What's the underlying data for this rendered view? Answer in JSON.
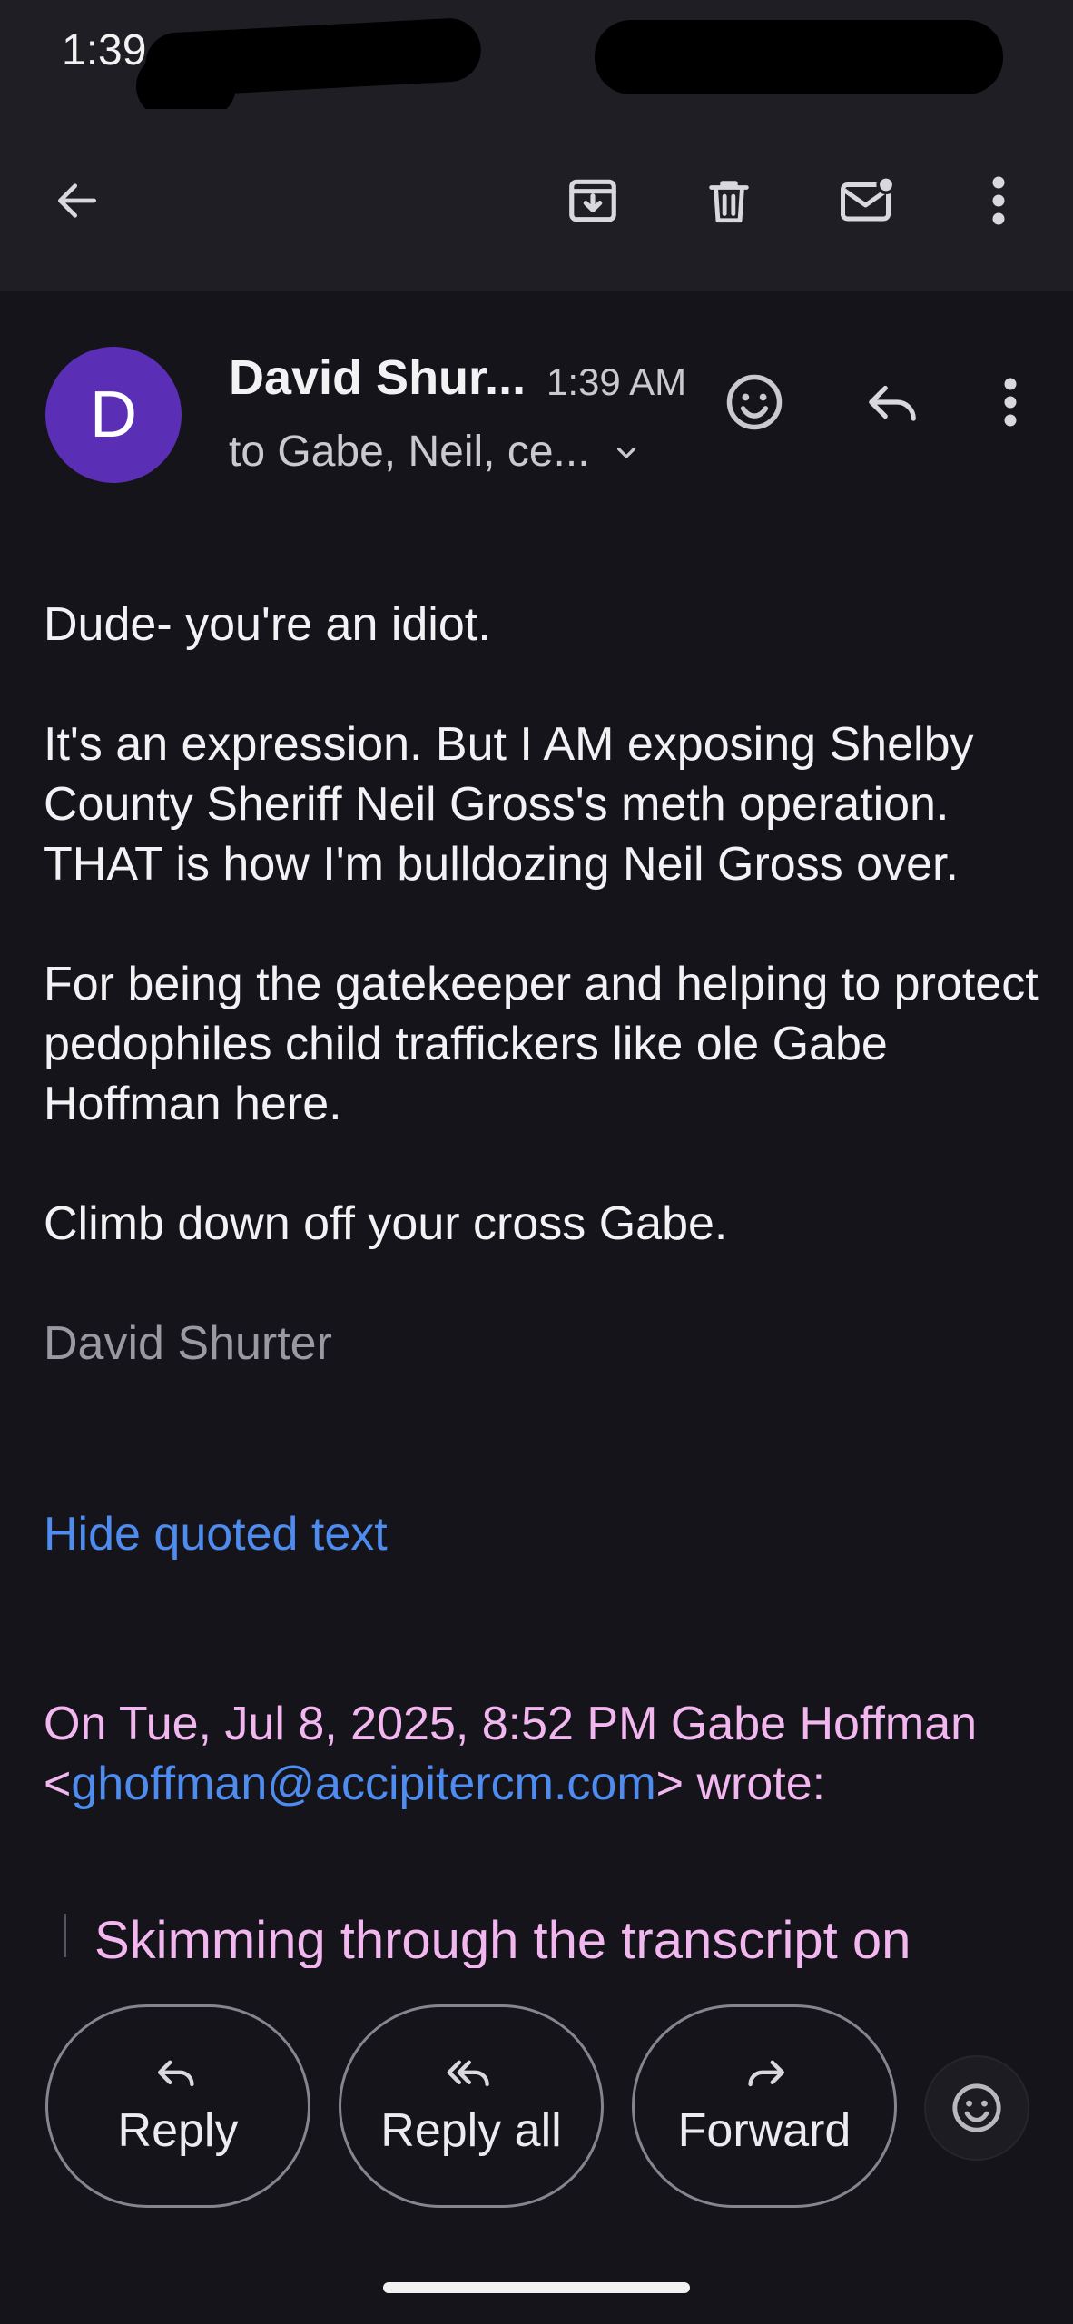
{
  "status_bar": {
    "time": "1:39"
  },
  "toolbar": {
    "back_icon": "arrow-left-icon",
    "archive_icon": "archive-icon",
    "delete_icon": "trash-icon",
    "mark_unread_icon": "mail-unread-icon",
    "more_icon": "more-vert-icon"
  },
  "message": {
    "avatar_letter": "D",
    "avatar_color": "#5b2fb5",
    "sender": "David Shur...",
    "time": "1:39 AM",
    "recipients": "to Gabe, Neil, ce...",
    "body": [
      "Dude- you're an idiot.",
      "It's an expression. But I AM exposing Shelby County Sheriff Neil Gross's meth operation. THAT is how I'm bulldozing Neil Gross over.",
      "For being the gatekeeper and helping to protect pedophiles child traffickers like ole Gabe Hoffman here.",
      "Climb down off your cross Gabe."
    ],
    "signature": "David Shurter",
    "hide_quoted": "Hide quoted text",
    "quote_intro_before": "On Tue, Jul 8, 2025, 8:52 PM Gabe Hoffman <",
    "quote_email": "ghoffman@accipitercm.com",
    "quote_intro_after": "> wrote:",
    "quote_text": "Skimming through the transcript on"
  },
  "actions": {
    "reply": "Reply",
    "reply_all": "Reply all",
    "forward": "Forward"
  },
  "colors": {
    "background": "#15141b",
    "bar": "#1f1e25",
    "link": "#4f8cf0",
    "quote": "#f3b7f0"
  }
}
